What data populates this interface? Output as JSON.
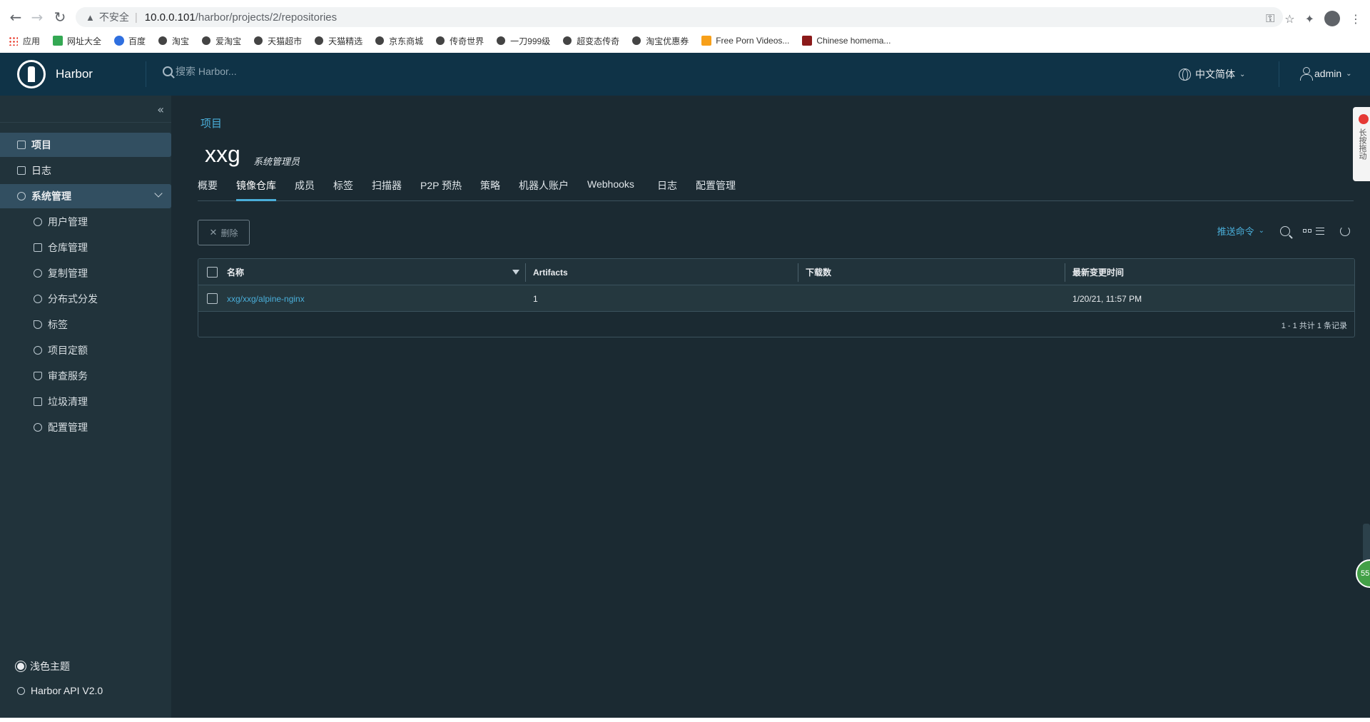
{
  "browser": {
    "insecure_label": "不安全",
    "url_host": "10.0.0.101",
    "url_path": "/harbor/projects/2/repositories",
    "bookmarks": [
      "应用",
      "网址大全",
      "百度",
      "淘宝",
      "爱淘宝",
      "天猫超市",
      "天猫精选",
      "京东商城",
      "传奇世界",
      "一刀999级",
      "超变态传奇",
      "淘宝优惠券",
      "Free Porn Videos...",
      "Chinese homema..."
    ]
  },
  "header": {
    "app_title": "Harbor",
    "search_placeholder": "搜索 Harbor...",
    "language": "中文简体",
    "user": "admin"
  },
  "sidebar": {
    "items": [
      {
        "label": "项目"
      },
      {
        "label": "日志"
      },
      {
        "label": "系统管理"
      },
      {
        "label": "用户管理"
      },
      {
        "label": "仓库管理"
      },
      {
        "label": "复制管理"
      },
      {
        "label": "分布式分发"
      },
      {
        "label": "标签"
      },
      {
        "label": "项目定额"
      },
      {
        "label": "审查服务"
      },
      {
        "label": "垃圾清理"
      },
      {
        "label": "配置管理"
      }
    ],
    "theme_toggle": "浅色主题",
    "api_link": "Harbor API V2.0"
  },
  "main": {
    "breadcrumb": "项目",
    "project_name": "xxg",
    "project_role": "系统管理员",
    "tabs": [
      "概要",
      "镜像仓库",
      "成员",
      "标签",
      "扫描器",
      "P2P 预热",
      "策略",
      "机器人账户",
      "Webhooks",
      "日志",
      "配置管理"
    ],
    "active_tab": "镜像仓库",
    "delete_label": "删除",
    "push_command_label": "推送命令",
    "table": {
      "columns": [
        "名称",
        "Artifacts",
        "下载数",
        "最新变更时间"
      ],
      "rows": [
        {
          "name": "xxg/xxg/alpine-nginx",
          "artifacts": "1",
          "downloads": "",
          "updated": "1/20/21, 11:57 PM"
        }
      ],
      "footer": "1 - 1 共计 1 条记录"
    }
  },
  "overlay": {
    "widget_text": "长按拖动",
    "badge_text": "55"
  }
}
